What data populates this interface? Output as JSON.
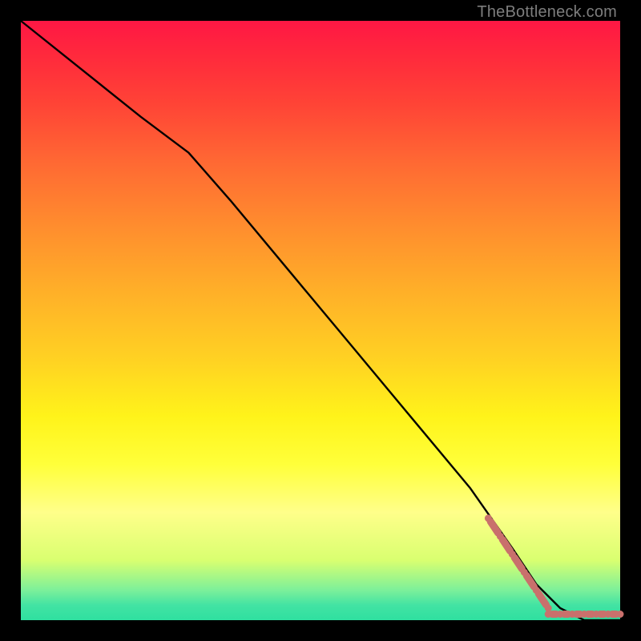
{
  "watermark": "TheBottleneck.com",
  "colors": {
    "frame": "#000000",
    "curve": "#000000",
    "marker": "#c9706c"
  },
  "chart_data": {
    "type": "line",
    "title": "",
    "xlabel": "",
    "ylabel": "",
    "xlim": [
      0,
      100
    ],
    "ylim": [
      0,
      100
    ],
    "grid": false,
    "legend": false,
    "series": [
      {
        "name": "black-curve",
        "style": "line",
        "x": [
          0,
          10,
          20,
          28,
          35,
          45,
          55,
          65,
          75,
          82,
          86,
          90,
          94,
          100
        ],
        "y": [
          100,
          92,
          84,
          78,
          70,
          58,
          46,
          34,
          22,
          12,
          6,
          2,
          0,
          0
        ]
      },
      {
        "name": "red-segment-diagonal",
        "style": "dashed-markers",
        "x": [
          78,
          80,
          82,
          84,
          86,
          88
        ],
        "y": [
          17,
          14,
          11,
          8,
          5,
          2
        ]
      },
      {
        "name": "red-segment-flat",
        "style": "dashed-markers",
        "x": [
          88,
          90,
          92,
          94,
          96,
          98,
          100
        ],
        "y": [
          1,
          1,
          1,
          1,
          1,
          1,
          1
        ]
      }
    ]
  }
}
